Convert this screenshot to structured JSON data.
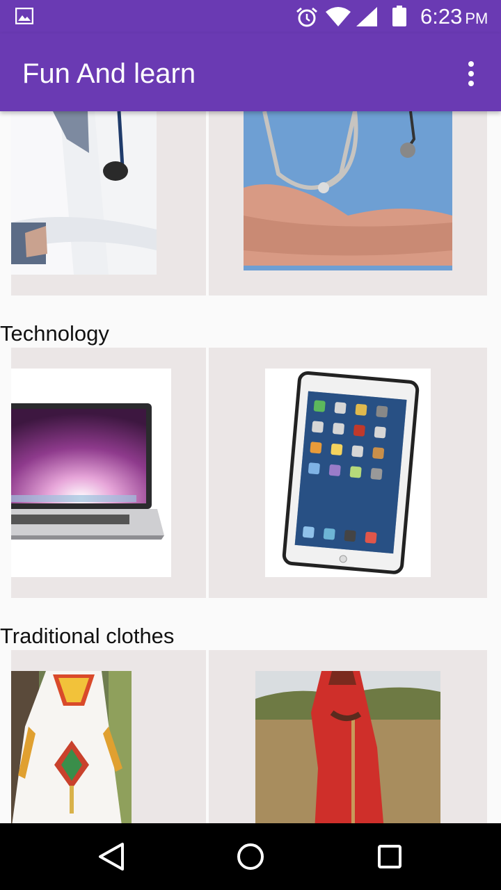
{
  "status_bar": {
    "time": "6:23",
    "ampm": "PM",
    "icons": [
      "gallery-icon",
      "alarm-icon",
      "wifi-icon",
      "signal-icon",
      "battery-icon"
    ]
  },
  "app_bar": {
    "title": "Fun And learn",
    "menu_icon": "overflow-menu-icon"
  },
  "sections": [
    {
      "title": "",
      "images": [
        "doctor-image",
        "nurse-image"
      ]
    },
    {
      "title": "Technology",
      "images": [
        "laptop-image",
        "tablet-image"
      ]
    },
    {
      "title": "Traditional clothes",
      "images": [
        "white-traditional-dress-image",
        "red-maasai-clothes-image"
      ]
    }
  ],
  "nav_bar": {
    "icons": [
      "back-icon",
      "home-icon",
      "recents-icon"
    ]
  },
  "colors": {
    "primary": "#6a3ab3",
    "card_bg": "#ebe6e6",
    "page_bg": "#fafafa"
  }
}
